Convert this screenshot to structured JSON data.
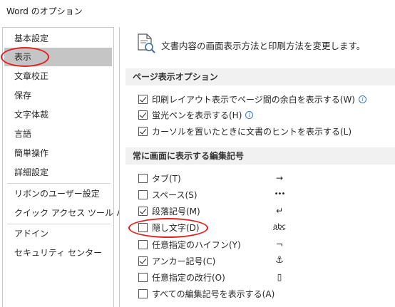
{
  "window": {
    "title": "Word のオプション"
  },
  "sidebar": {
    "items": [
      {
        "label": "基本設定"
      },
      {
        "label": "表示"
      },
      {
        "label": "文章校正"
      },
      {
        "label": "保存"
      },
      {
        "label": "文字体裁"
      },
      {
        "label": "言語"
      },
      {
        "label": "簡単操作"
      },
      {
        "label": "詳細設定"
      },
      {
        "label": "リボンのユーザー設定"
      },
      {
        "label": "クイック アクセス ツール バー"
      },
      {
        "label": "アドイン"
      },
      {
        "label": "セキュリティ センター"
      }
    ],
    "selected": "表示"
  },
  "header": {
    "description": "文書内容の画面表示方法と印刷方法を変更します。"
  },
  "page_display": {
    "heading": "ページ表示オプション",
    "options": [
      {
        "label": "印刷レイアウト表示でページ間の余白を表示する(W)",
        "checked": true,
        "info_icon": true
      },
      {
        "label": "蛍光ペンを表示する(H)",
        "checked": true,
        "info_icon": true
      },
      {
        "label": "カーソルを置いたときに文書のヒントを表示する(L)",
        "checked": true,
        "info_icon": false
      }
    ]
  },
  "formatting_marks": {
    "heading": "常に画面に表示する編集記号",
    "options": [
      {
        "label": "タブ(T)",
        "checked": false,
        "symbol": "→"
      },
      {
        "label": "スペース(S)",
        "checked": false,
        "symbol": "•••"
      },
      {
        "label": "段落記号(M)",
        "checked": true,
        "symbol": "↵"
      },
      {
        "label": "隠し文字(D)",
        "checked": false,
        "symbol": "abc"
      },
      {
        "label": "任意指定のハイフン(Y)",
        "checked": false,
        "symbol": "¬"
      },
      {
        "label": "アンカー記号(C)",
        "checked": true,
        "symbol": "⚓"
      },
      {
        "label": "任意指定の改行(O)",
        "checked": false,
        "symbol": "▯"
      },
      {
        "label": "すべての編集記号を表示する(A)",
        "checked": false,
        "symbol": ""
      }
    ]
  },
  "colors": {
    "annotation": "#e02020",
    "selected_bg": "#c5c5c5",
    "info": "#3b78c4"
  }
}
